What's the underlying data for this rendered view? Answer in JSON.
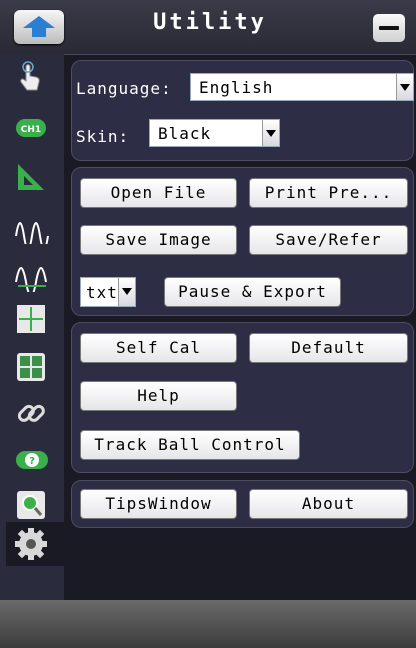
{
  "header": {
    "title": "Utility"
  },
  "sidebar": {
    "items": [
      {
        "icon": "touch-hand-icon"
      },
      {
        "icon": "channel-ch1-icon"
      },
      {
        "icon": "cursor-ruler-icon"
      },
      {
        "icon": "waveform-measure-icon"
      },
      {
        "icon": "waveform-width-icon"
      },
      {
        "icon": "display-grid-icon"
      },
      {
        "icon": "math-calc-icon"
      },
      {
        "icon": "link-icon"
      },
      {
        "icon": "pass-fail-icon"
      },
      {
        "icon": "zoom-icon"
      },
      {
        "icon": "gear-icon"
      }
    ]
  },
  "general": {
    "language_label": "Language:",
    "language_value": "English",
    "skin_label": "Skin:",
    "skin_value": "Black"
  },
  "file": {
    "open_file": "Open File",
    "print_preview": "Print Pre...",
    "save_image": "Save Image",
    "save_refer": "Save/Refer",
    "format_value": "txt",
    "pause_export": "Pause & Export"
  },
  "system": {
    "self_cal": "Self Cal",
    "default": "Default",
    "help": "Help",
    "track_ball": "Track Ball Control"
  },
  "info": {
    "tips_window": "TipsWindow",
    "about": "About"
  },
  "colors": {
    "background": "#1a1a24",
    "panel": "#2d2d45",
    "sidebar": "#2b2b3e",
    "accent": "#2a7fd4"
  }
}
